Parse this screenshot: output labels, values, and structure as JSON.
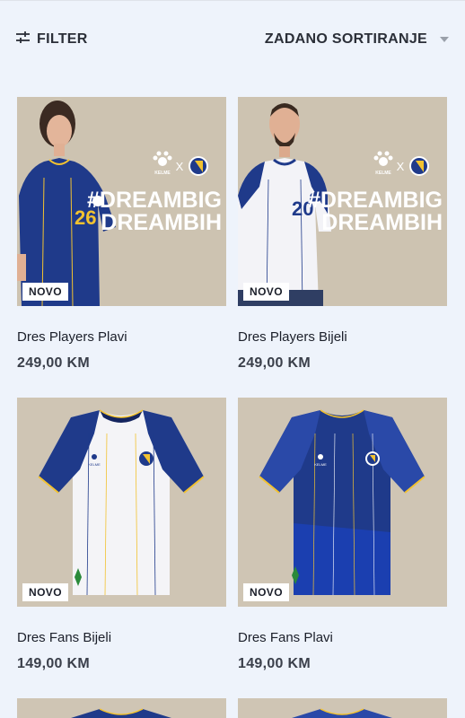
{
  "toolbar": {
    "filter_label": "FILTER",
    "filter_icon": "sliders-icon",
    "sort_label": "ZADANO SORTIRANJE",
    "sort_icon": "caret-down-icon"
  },
  "products": [
    {
      "title": "Dres Players Plavi",
      "price": "249,00 KM",
      "badge": "NOVO",
      "promo_line1": "#DREAMBIG",
      "promo_line2": "DREAMBIH",
      "brand_text": "KELME",
      "cross": "X",
      "jersey_number": "26"
    },
    {
      "title": "Dres Players Bijeli",
      "price": "249,00 KM",
      "badge": "NOVO",
      "promo_line1": "#DREAMBIG",
      "promo_line2": "DREAMBIH",
      "brand_text": "KELME",
      "cross": "X",
      "jersey_number": "20"
    },
    {
      "title": "Dres Fans Bijeli",
      "price": "149,00 KM",
      "badge": "NOVO",
      "brand_text": "KELME"
    },
    {
      "title": "Dres Fans Plavi",
      "price": "149,00 KM",
      "badge": "NOVO",
      "brand_text": "KELME"
    }
  ],
  "colors": {
    "page_bg": "#eef3fb",
    "navy": "#1f3a8a",
    "navy_dark": "#14245e",
    "yellow": "#f2c230",
    "photo_bg": "#c9bfad"
  }
}
